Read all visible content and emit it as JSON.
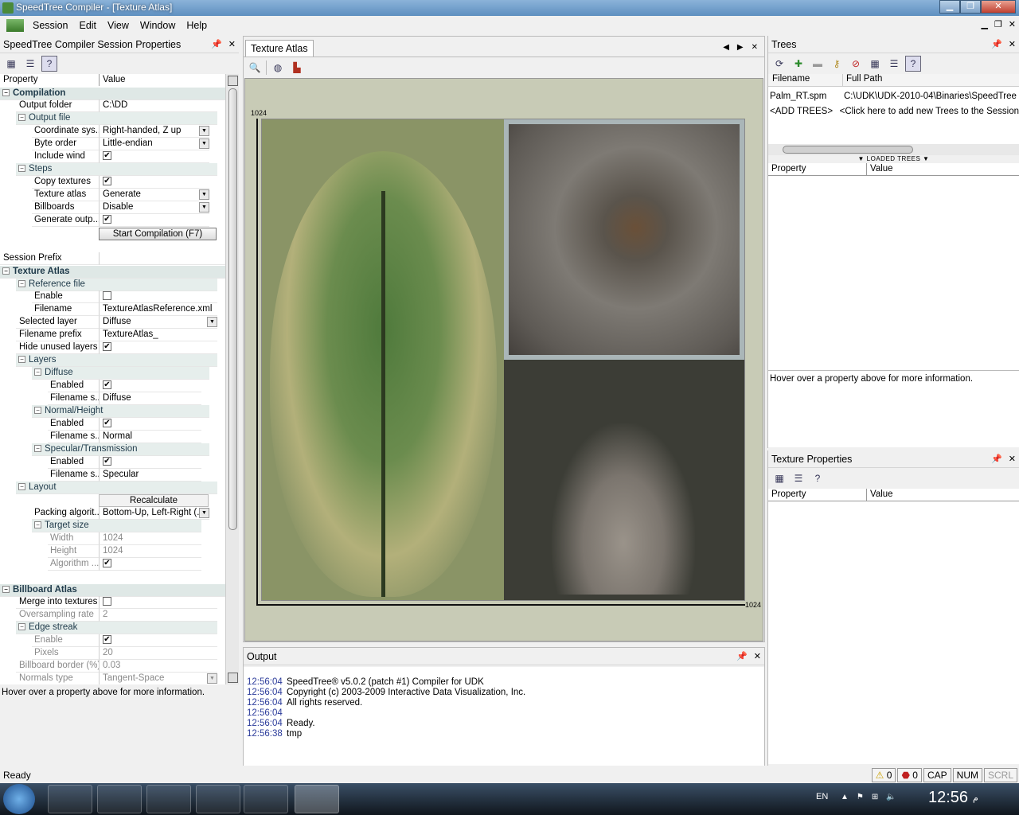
{
  "window": {
    "title": "SpeedTree Compiler - [Texture Atlas]"
  },
  "menu": [
    "Session",
    "Edit",
    "View",
    "Window",
    "Help"
  ],
  "left_panel": {
    "title": "SpeedTree Compiler Session Properties",
    "col_property": "Property",
    "col_value": "Value",
    "rows": {
      "compilation": "Compilation",
      "output_folder": {
        "name": "Output folder",
        "value": "C:\\DD"
      },
      "output_file": "Output file",
      "coord_sys": {
        "name": "Coordinate sys...",
        "value": "Right-handed, Z up"
      },
      "byte_order": {
        "name": "Byte order",
        "value": "Little-endian"
      },
      "include_wind": {
        "name": "Include wind",
        "value": "✔"
      },
      "steps": "Steps",
      "copy_textures": {
        "name": "Copy textures",
        "value": "✔"
      },
      "texture_atlas_step": {
        "name": "Texture atlas",
        "value": "Generate"
      },
      "billboards": {
        "name": "Billboards",
        "value": "Disable"
      },
      "generate_output": {
        "name": "Generate outp...",
        "value": "✔"
      },
      "start_compilation": "Start Compilation (F7)",
      "session_prefix": {
        "name": "Session Prefix",
        "value": ""
      },
      "texture_atlas": "Texture Atlas",
      "reference_file": "Reference file",
      "ref_enable": {
        "name": "Enable",
        "value": ""
      },
      "ref_filename": {
        "name": "Filename",
        "value": "TextureAtlasReference.xml"
      },
      "selected_layer": {
        "name": "Selected layer",
        "value": "Diffuse"
      },
      "filename_prefix": {
        "name": "Filename prefix",
        "value": "TextureAtlas_"
      },
      "hide_unused": {
        "name": "Hide unused layers",
        "value": "✔"
      },
      "layers": "Layers",
      "diffuse": "Diffuse",
      "diffuse_enabled": {
        "name": "Enabled",
        "value": "✔"
      },
      "diffuse_suffix": {
        "name": "Filename s...",
        "value": "Diffuse"
      },
      "normal": "Normal/Height",
      "normal_enabled": {
        "name": "Enabled",
        "value": "✔"
      },
      "normal_suffix": {
        "name": "Filename s...",
        "value": "Normal"
      },
      "specular": "Specular/Transmission",
      "specular_enabled": {
        "name": "Enabled",
        "value": "✔"
      },
      "specular_suffix": {
        "name": "Filename s...",
        "value": "Specular"
      },
      "layout": "Layout",
      "recalculate": "Recalculate",
      "packing": {
        "name": "Packing algorit...",
        "value": "Bottom-Up, Left-Right (..."
      },
      "target_size": "Target size",
      "width": {
        "name": "Width",
        "value": "1024"
      },
      "height": {
        "name": "Height",
        "value": "1024"
      },
      "algorithm": {
        "name": "Algorithm ...",
        "value": "✔"
      },
      "billboard_atlas": "Billboard Atlas",
      "merge": {
        "name": "Merge into textures",
        "value": ""
      },
      "oversampling": {
        "name": "Oversampling rate",
        "value": "2"
      },
      "edge_streak": "Edge streak",
      "edge_enable": {
        "name": "Enable",
        "value": "✔"
      },
      "pixels": {
        "name": "Pixels",
        "value": "20"
      },
      "bb_border": {
        "name": "Billboard border (%)",
        "value": "0.03"
      },
      "normals_type": {
        "name": "Normals type",
        "value": "Tangent-Space"
      }
    },
    "hint": "Hover over a property above for more information."
  },
  "center": {
    "tab": "Texture Atlas",
    "axis_top": "1024",
    "axis_right": "1024"
  },
  "output": {
    "title": "Output",
    "lines": [
      {
        "time": "12:56:04",
        "text": "SpeedTree® v5.0.2 (patch #1) Compiler for UDK"
      },
      {
        "time": "12:56:04",
        "text": "Copyright (c) 2003-2009 Interactive Data Visualization, Inc."
      },
      {
        "time": "12:56:04",
        "text": "All rights reserved."
      },
      {
        "time": "12:56:04",
        "text": ""
      },
      {
        "time": "12:56:04",
        "text": "Ready."
      },
      {
        "time": "12:56:38",
        "text": "tmp"
      }
    ]
  },
  "trees": {
    "title": "Trees",
    "col_filename": "Filename",
    "col_fullpath": "Full Path",
    "rows": [
      {
        "file": "Palm_RT.spm",
        "path": "C:\\UDK\\UDK-2010-04\\Binaries\\SpeedTree"
      },
      {
        "file": "<ADD TREES>",
        "path": "<Click here to add new Trees to the Session"
      }
    ],
    "loaded_label": "LOADED TREES",
    "col_property": "Property",
    "col_value": "Value",
    "hint": "Hover over a property above for more information."
  },
  "texture_props": {
    "title": "Texture Properties",
    "col_property": "Property",
    "col_value": "Value"
  },
  "status": {
    "ready": "Ready",
    "warnings": "0",
    "errors": "0",
    "cap": "CAP",
    "num": "NUM",
    "scrl": "SCRL"
  },
  "taskbar": {
    "lang": "EN",
    "clock": "12:56",
    "suffix": "م"
  }
}
